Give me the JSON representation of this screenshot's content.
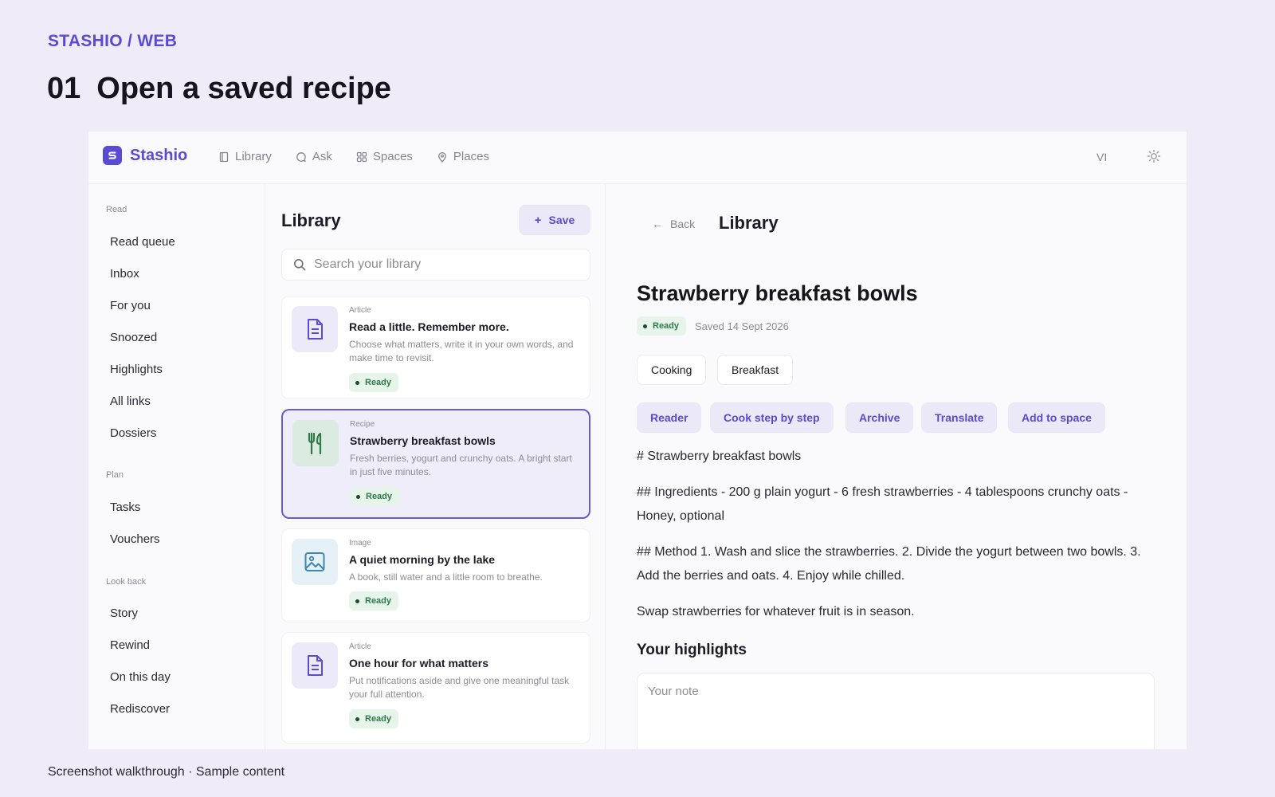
{
  "slide": {
    "eyebrow": "STASHIO / WEB",
    "step_number": "01",
    "title": "Open a saved recipe",
    "footer": "Screenshot walkthrough · Sample content"
  },
  "topbar": {
    "brand": "Stashio",
    "nav": [
      {
        "label": "Library",
        "icon": "book-icon"
      },
      {
        "label": "Ask",
        "icon": "chat-icon"
      },
      {
        "label": "Spaces",
        "icon": "grid-icon"
      },
      {
        "label": "Places",
        "icon": "map-pin-icon"
      }
    ],
    "user_initials": "VI",
    "theme_icon": "sun-icon"
  },
  "sidebar": {
    "groups": [
      {
        "label": "Read",
        "items": [
          "Read queue",
          "Inbox",
          "For you",
          "Snoozed",
          "Highlights",
          "All links",
          "Dossiers"
        ]
      },
      {
        "label": "Plan",
        "items": [
          "Tasks",
          "Vouchers"
        ]
      },
      {
        "label": "Look back",
        "items": [
          "Story",
          "Rewind",
          "On this day",
          "Rediscover"
        ]
      }
    ]
  },
  "library": {
    "title": "Library",
    "save_label": "Save",
    "search_placeholder": "Search your library",
    "cards": [
      {
        "kind": "Article",
        "title": "Read a little. Remember more.",
        "desc": "Choose what matters, write it in your own words, and make time to revisit.",
        "status": "Ready",
        "icon": "document-icon",
        "selected": false
      },
      {
        "kind": "Recipe",
        "title": "Strawberry breakfast bowls",
        "desc": "Fresh berries, yogurt and crunchy oats. A bright start in just five minutes.",
        "status": "Ready",
        "icon": "fork-knife-icon",
        "selected": true
      },
      {
        "kind": "Image",
        "title": "A quiet morning by the lake",
        "desc": "A book, still water and a little room to breathe.",
        "status": "Ready",
        "icon": "image-icon",
        "selected": false
      },
      {
        "kind": "Article",
        "title": "One hour for what matters",
        "desc": "Put notifications aside and give one meaningful task your full attention.",
        "status": "Ready",
        "icon": "document-icon",
        "selected": false
      }
    ]
  },
  "detail": {
    "back_label": "Back",
    "crumb": "Library",
    "title": "Strawberry breakfast bowls",
    "status": "Ready",
    "saved": "Saved 14 Sept 2026",
    "tags": [
      "Cooking",
      "Breakfast"
    ],
    "actions": [
      "Reader",
      "Cook step by step",
      "Archive",
      "Translate",
      "Add to space"
    ],
    "paragraphs": [
      "# Strawberry breakfast bowls",
      "## Ingredients - 200 g plain yogurt - 6 fresh strawberries - 4 tablespoons crunchy oats - Honey, optional",
      "## Method 1. Wash and slice the strawberries. 2. Divide the yogurt between two bowls. 3. Add the berries and oats. 4. Enjoy while chilled.",
      "Swap strawberries for whatever fruit is in season."
    ],
    "highlights_heading": "Your highlights",
    "note_placeholder": "Your note"
  },
  "colors": {
    "accent": "#5a4bd1",
    "background": "#efebf8",
    "ready_badge_bg": "#e6f4ea",
    "ready_badge_text": "#2f7a4a"
  }
}
